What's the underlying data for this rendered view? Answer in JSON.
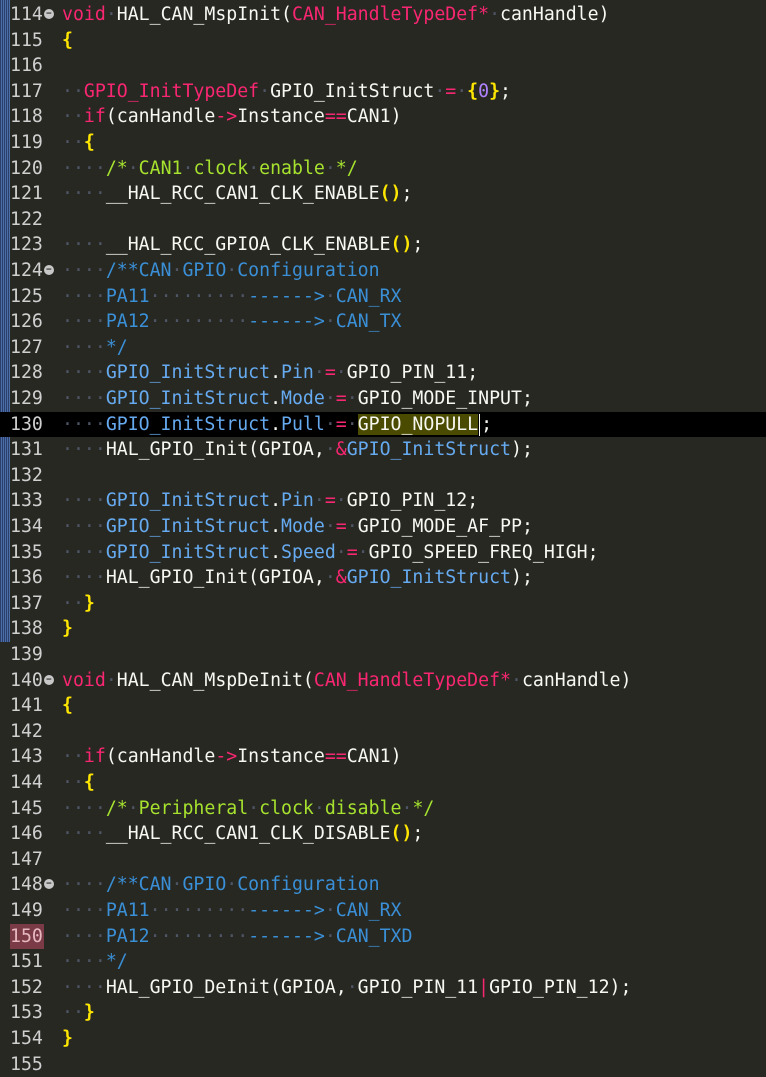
{
  "editor": {
    "cursor_line": "130",
    "selected_line": "150",
    "fold_glyph": "−",
    "lines": [
      {
        "num": "114",
        "fold": true,
        "tokens": [
          [
            "ty",
            "void"
          ],
          [
            "ws",
            "·"
          ],
          [
            "fn",
            "HAL_CAN_MspInit"
          ],
          [
            "pu",
            "("
          ],
          [
            "ty",
            "CAN_HandleTypeDef"
          ],
          [
            "op",
            "*"
          ],
          [
            "ws",
            "·"
          ],
          [
            "id",
            "canHandle"
          ],
          [
            "pu",
            ")"
          ]
        ]
      },
      {
        "num": "115",
        "tokens": [
          [
            "br",
            "{"
          ]
        ]
      },
      {
        "num": "116",
        "tokens": []
      },
      {
        "num": "117",
        "tokens": [
          [
            "ws",
            "··"
          ],
          [
            "ty",
            "GPIO_InitTypeDef"
          ],
          [
            "ws",
            "·"
          ],
          [
            "id",
            "GPIO_InitStruct"
          ],
          [
            "ws",
            "·"
          ],
          [
            "op",
            "="
          ],
          [
            "ws",
            "·"
          ],
          [
            "br",
            "{"
          ],
          [
            "num",
            "0"
          ],
          [
            "br",
            "}"
          ],
          [
            "pu",
            ";"
          ]
        ]
      },
      {
        "num": "118",
        "tokens": [
          [
            "ws",
            "··"
          ],
          [
            "kw",
            "if"
          ],
          [
            "pu",
            "("
          ],
          [
            "id",
            "canHandle"
          ],
          [
            "op",
            "->"
          ],
          [
            "id",
            "Instance"
          ],
          [
            "op",
            "=="
          ],
          [
            "id",
            "CAN1"
          ],
          [
            "pu",
            ")"
          ]
        ]
      },
      {
        "num": "119",
        "tokens": [
          [
            "ws",
            "··"
          ],
          [
            "br",
            "{"
          ]
        ]
      },
      {
        "num": "120",
        "tokens": [
          [
            "ws",
            "····"
          ],
          [
            "cm",
            "/*"
          ],
          [
            "ws",
            "·"
          ],
          [
            "cm",
            "CAN1"
          ],
          [
            "ws",
            "·"
          ],
          [
            "cm",
            "clock"
          ],
          [
            "ws",
            "·"
          ],
          [
            "cm",
            "enable"
          ],
          [
            "ws",
            "·"
          ],
          [
            "cm",
            "*/"
          ]
        ]
      },
      {
        "num": "121",
        "tokens": [
          [
            "ws",
            "····"
          ],
          [
            "mac",
            "__HAL_RCC_CAN1_CLK_ENABLE"
          ],
          [
            "br",
            "()"
          ],
          [
            "pu",
            ";"
          ]
        ]
      },
      {
        "num": "122",
        "tokens": []
      },
      {
        "num": "123",
        "tokens": [
          [
            "ws",
            "····"
          ],
          [
            "mac",
            "__HAL_RCC_GPIOA_CLK_ENABLE"
          ],
          [
            "br",
            "()"
          ],
          [
            "pu",
            ";"
          ]
        ]
      },
      {
        "num": "124",
        "fold": true,
        "tokens": [
          [
            "ws",
            "····"
          ],
          [
            "dc",
            "/**CAN"
          ],
          [
            "ws",
            "·"
          ],
          [
            "dc",
            "GPIO"
          ],
          [
            "ws",
            "·"
          ],
          [
            "dc",
            "Configuration"
          ]
        ]
      },
      {
        "num": "125",
        "tokens": [
          [
            "ws",
            "····"
          ],
          [
            "dc",
            "PA11"
          ],
          [
            "ws",
            "·········"
          ],
          [
            "dc",
            "------>"
          ],
          [
            "ws",
            "·"
          ],
          [
            "dc",
            "CAN_RX"
          ]
        ]
      },
      {
        "num": "126",
        "tokens": [
          [
            "ws",
            "····"
          ],
          [
            "dc",
            "PA12"
          ],
          [
            "ws",
            "·········"
          ],
          [
            "dc",
            "------>"
          ],
          [
            "ws",
            "·"
          ],
          [
            "dc",
            "CAN_TX"
          ]
        ]
      },
      {
        "num": "127",
        "tokens": [
          [
            "ws",
            "····"
          ],
          [
            "dc",
            "*/"
          ]
        ]
      },
      {
        "num": "128",
        "tokens": [
          [
            "ws",
            "····"
          ],
          [
            "fld",
            "GPIO_InitStruct"
          ],
          [
            "pu",
            "."
          ],
          [
            "fld",
            "Pin"
          ],
          [
            "ws",
            "·"
          ],
          [
            "op",
            "="
          ],
          [
            "ws",
            "·"
          ],
          [
            "mac",
            "GPIO_PIN_11"
          ],
          [
            "pu",
            ";"
          ]
        ]
      },
      {
        "num": "129",
        "tokens": [
          [
            "ws",
            "····"
          ],
          [
            "fld",
            "GPIO_InitStruct"
          ],
          [
            "pu",
            "."
          ],
          [
            "fld",
            "Mode"
          ],
          [
            "ws",
            "·"
          ],
          [
            "op",
            "="
          ],
          [
            "ws",
            "·"
          ],
          [
            "mac",
            "GPIO_MODE_INPUT"
          ],
          [
            "pu",
            ";"
          ]
        ]
      },
      {
        "num": "130",
        "cur": true,
        "tokens": [
          [
            "ws",
            "····"
          ],
          [
            "fld",
            "GPIO_InitStruct"
          ],
          [
            "pu",
            "."
          ],
          [
            "fld",
            "Pull"
          ],
          [
            "ws",
            "·"
          ],
          [
            "op",
            "="
          ],
          [
            "ws",
            "·"
          ],
          [
            "hl",
            "GPIO_NOPULL"
          ],
          [
            "caret",
            ""
          ],
          [
            "pu",
            ";"
          ]
        ]
      },
      {
        "num": "131",
        "tokens": [
          [
            "ws",
            "····"
          ],
          [
            "fn",
            "HAL_GPIO_Init"
          ],
          [
            "pu",
            "("
          ],
          [
            "id",
            "GPIOA"
          ],
          [
            "pu",
            ","
          ],
          [
            "ws",
            "·"
          ],
          [
            "op",
            "&"
          ],
          [
            "fld",
            "GPIO_InitStruct"
          ],
          [
            "pu",
            ")"
          ],
          [
            "pu",
            ";"
          ]
        ]
      },
      {
        "num": "132",
        "tokens": []
      },
      {
        "num": "133",
        "tokens": [
          [
            "ws",
            "····"
          ],
          [
            "fld",
            "GPIO_InitStruct"
          ],
          [
            "pu",
            "."
          ],
          [
            "fld",
            "Pin"
          ],
          [
            "ws",
            "·"
          ],
          [
            "op",
            "="
          ],
          [
            "ws",
            "·"
          ],
          [
            "mac",
            "GPIO_PIN_12"
          ],
          [
            "pu",
            ";"
          ]
        ]
      },
      {
        "num": "134",
        "tokens": [
          [
            "ws",
            "····"
          ],
          [
            "fld",
            "GPIO_InitStruct"
          ],
          [
            "pu",
            "."
          ],
          [
            "fld",
            "Mode"
          ],
          [
            "ws",
            "·"
          ],
          [
            "op",
            "="
          ],
          [
            "ws",
            "·"
          ],
          [
            "mac",
            "GPIO_MODE_AF_PP"
          ],
          [
            "pu",
            ";"
          ]
        ]
      },
      {
        "num": "135",
        "tokens": [
          [
            "ws",
            "····"
          ],
          [
            "fld",
            "GPIO_InitStruct"
          ],
          [
            "pu",
            "."
          ],
          [
            "fld",
            "Speed"
          ],
          [
            "ws",
            "·"
          ],
          [
            "op",
            "="
          ],
          [
            "ws",
            "·"
          ],
          [
            "mac",
            "GPIO_SPEED_FREQ_HIGH"
          ],
          [
            "pu",
            ";"
          ]
        ]
      },
      {
        "num": "136",
        "tokens": [
          [
            "ws",
            "····"
          ],
          [
            "fn",
            "HAL_GPIO_Init"
          ],
          [
            "pu",
            "("
          ],
          [
            "id",
            "GPIOA"
          ],
          [
            "pu",
            ","
          ],
          [
            "ws",
            "·"
          ],
          [
            "op",
            "&"
          ],
          [
            "fld",
            "GPIO_InitStruct"
          ],
          [
            "pu",
            ")"
          ],
          [
            "pu",
            ";"
          ]
        ]
      },
      {
        "num": "137",
        "tokens": [
          [
            "ws",
            "··"
          ],
          [
            "br",
            "}"
          ]
        ]
      },
      {
        "num": "138",
        "tokens": [
          [
            "br",
            "}"
          ]
        ]
      },
      {
        "num": "139",
        "tokens": []
      },
      {
        "num": "140",
        "fold": true,
        "tokens": [
          [
            "ty",
            "void"
          ],
          [
            "ws",
            "·"
          ],
          [
            "fn",
            "HAL_CAN_MspDeInit"
          ],
          [
            "pu",
            "("
          ],
          [
            "ty",
            "CAN_HandleTypeDef"
          ],
          [
            "op",
            "*"
          ],
          [
            "ws",
            "·"
          ],
          [
            "id",
            "canHandle"
          ],
          [
            "pu",
            ")"
          ]
        ]
      },
      {
        "num": "141",
        "tokens": [
          [
            "br",
            "{"
          ]
        ]
      },
      {
        "num": "142",
        "tokens": []
      },
      {
        "num": "143",
        "tokens": [
          [
            "ws",
            "··"
          ],
          [
            "kw",
            "if"
          ],
          [
            "pu",
            "("
          ],
          [
            "id",
            "canHandle"
          ],
          [
            "op",
            "->"
          ],
          [
            "id",
            "Instance"
          ],
          [
            "op",
            "=="
          ],
          [
            "id",
            "CAN1"
          ],
          [
            "pu",
            ")"
          ]
        ]
      },
      {
        "num": "144",
        "tokens": [
          [
            "ws",
            "··"
          ],
          [
            "br",
            "{"
          ]
        ]
      },
      {
        "num": "145",
        "tokens": [
          [
            "ws",
            "····"
          ],
          [
            "cm",
            "/*"
          ],
          [
            "ws",
            "·"
          ],
          [
            "cm",
            "Peripheral"
          ],
          [
            "ws",
            "·"
          ],
          [
            "cm",
            "clock"
          ],
          [
            "ws",
            "·"
          ],
          [
            "cm",
            "disable"
          ],
          [
            "ws",
            "·"
          ],
          [
            "cm",
            "*/"
          ]
        ]
      },
      {
        "num": "146",
        "tokens": [
          [
            "ws",
            "····"
          ],
          [
            "mac",
            "__HAL_RCC_CAN1_CLK_DISABLE"
          ],
          [
            "br",
            "()"
          ],
          [
            "pu",
            ";"
          ]
        ]
      },
      {
        "num": "147",
        "tokens": []
      },
      {
        "num": "148",
        "fold": true,
        "tokens": [
          [
            "ws",
            "····"
          ],
          [
            "dc",
            "/**CAN"
          ],
          [
            "ws",
            "·"
          ],
          [
            "dc",
            "GPIO"
          ],
          [
            "ws",
            "·"
          ],
          [
            "dc",
            "Configuration"
          ]
        ]
      },
      {
        "num": "149",
        "tokens": [
          [
            "ws",
            "····"
          ],
          [
            "dc",
            "PA11"
          ],
          [
            "ws",
            "·········"
          ],
          [
            "dc",
            "------>"
          ],
          [
            "ws",
            "·"
          ],
          [
            "dc",
            "CAN_RX"
          ]
        ]
      },
      {
        "num": "150",
        "sel": true,
        "tokens": [
          [
            "ws",
            "····"
          ],
          [
            "dc",
            "PA12"
          ],
          [
            "ws",
            "·········"
          ],
          [
            "dc",
            "------>"
          ],
          [
            "ws",
            "·"
          ],
          [
            "dc",
            "CAN_TXD"
          ]
        ]
      },
      {
        "num": "151",
        "tokens": [
          [
            "ws",
            "····"
          ],
          [
            "dc",
            "*/"
          ]
        ]
      },
      {
        "num": "152",
        "tokens": [
          [
            "ws",
            "····"
          ],
          [
            "fn",
            "HAL_GPIO_DeInit"
          ],
          [
            "pu",
            "("
          ],
          [
            "id",
            "GPIOA"
          ],
          [
            "pu",
            ","
          ],
          [
            "ws",
            "·"
          ],
          [
            "mac",
            "GPIO_PIN_11"
          ],
          [
            "op",
            "|"
          ],
          [
            "mac",
            "GPIO_PIN_12"
          ],
          [
            "pu",
            ")"
          ],
          [
            "pu",
            ";"
          ]
        ]
      },
      {
        "num": "153",
        "tokens": [
          [
            "ws",
            "··"
          ],
          [
            "br",
            "}"
          ]
        ]
      },
      {
        "num": "154",
        "tokens": [
          [
            "br",
            "}"
          ]
        ]
      },
      {
        "num": "155",
        "tokens": []
      }
    ]
  }
}
